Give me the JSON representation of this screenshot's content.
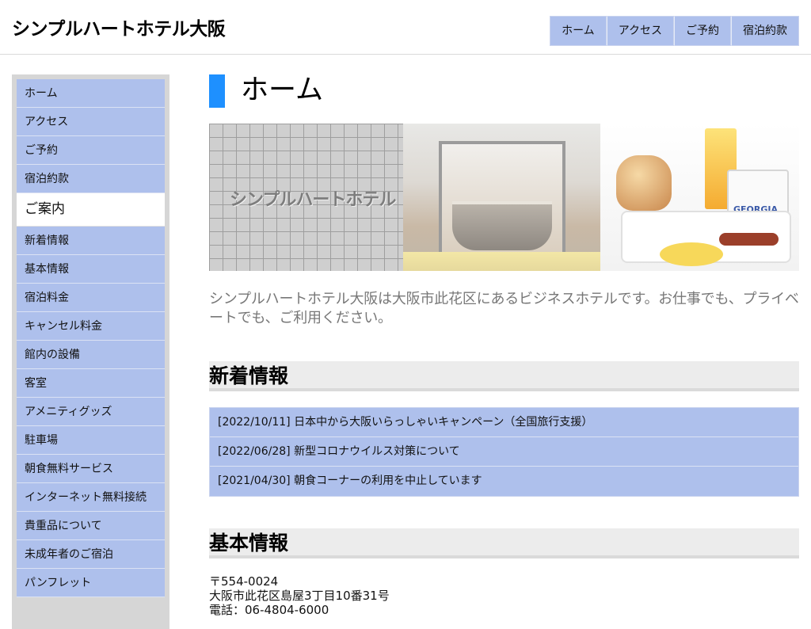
{
  "header": {
    "title": "シンプルハートホテル大阪",
    "nav": [
      "ホーム",
      "アクセス",
      "ご予約",
      "宿泊約款"
    ]
  },
  "sidebar": {
    "top_items": [
      "ホーム",
      "アクセス",
      "ご予約",
      "宿泊約款"
    ],
    "section_heading": "ご案内",
    "guide_items": [
      "新着情報",
      "基本情報",
      "宿泊料金",
      "キャンセル料金",
      "館内の設備",
      "客室",
      "アメニティグッズ",
      "駐車場",
      "朝食無料サービス",
      "インターネット無料接続",
      "貴重品について",
      "未成年者のご宿泊",
      "パンフレット"
    ]
  },
  "main": {
    "page_title": "ホーム",
    "hero_sign": "シンプルハートホテル",
    "hero_cup_label": "GEORGIA",
    "intro": "シンプルハートホテル大阪は大阪市此花区にあるビジネスホテルです。お仕事でも、プライベートでも、ご利用ください。",
    "news_heading": "新着情報",
    "news": [
      "[2022/10/11] 日本中から大阪いらっしゃいキャンペーン（全国旅行支援）",
      "[2022/06/28] 新型コロナウイルス対策について",
      "[2021/04/30] 朝食コーナーの利用を中止しています"
    ],
    "basic_heading": "基本情報",
    "address": {
      "postal": "〒554-0024",
      "street": "大阪市此花区島屋3丁目10番31号",
      "phone": "電話：06-4804-6000"
    }
  },
  "colors": {
    "nav_bg": "#aec0ec",
    "accent_bar": "#1e90ff",
    "section_bg": "#ececec"
  }
}
